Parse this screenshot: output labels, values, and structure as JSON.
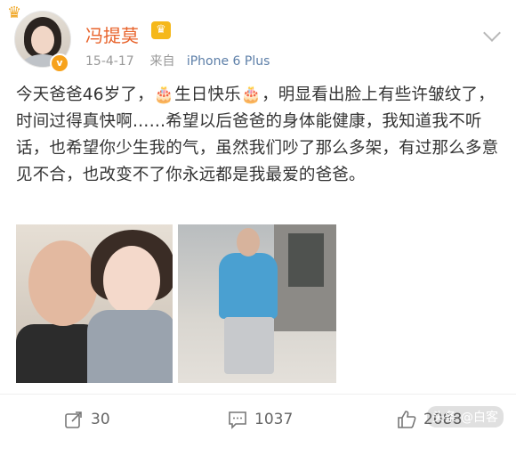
{
  "header": {
    "username": "冯提莫",
    "meta_date": "15-4-17",
    "meta_source_prefix": "来自",
    "meta_device": "iPhone 6 Plus",
    "verified_badge": "v"
  },
  "post": {
    "text": "今天爸爸46岁了，🎂生日快乐🎂，明显看出脸上有些许皱纹了，时间过得真快啊……希望以后爸爸的身体能健康，我知道我不听话，也希望你少生我的气，虽然我们吵了那么多架，有过那么多意见不合，也改变不了你永远都是我最爱的爸爸。"
  },
  "actions": {
    "repost_count": "30",
    "comment_count": "1037",
    "like_count": "2088"
  },
  "watermark": {
    "text": "头条 @白客"
  },
  "icons": {
    "crown": "crown-icon",
    "member": "member-icon",
    "chevron": "chevron-down-icon",
    "repost": "repost-icon",
    "comment": "comment-icon",
    "like": "like-icon"
  },
  "colors": {
    "username": "#e8632b",
    "device_link": "#5d7fa8",
    "badge": "#f7a21b"
  }
}
